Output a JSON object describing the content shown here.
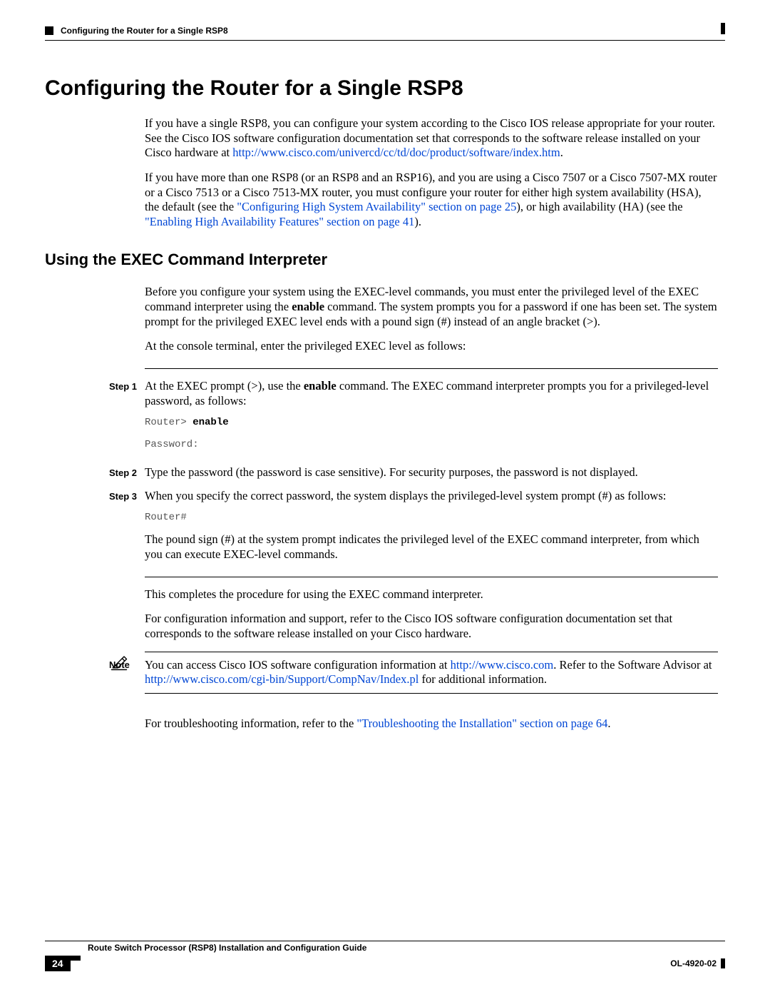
{
  "header": {
    "running_title": "Configuring the Router for a Single RSP8"
  },
  "h1": "Configuring the Router for a Single RSP8",
  "p1a": "If you have a single RSP8, you can configure your system according to the Cisco IOS release appropriate for your router. See the Cisco IOS software configuration documentation set that corresponds to the software release installed on your Cisco hardware at ",
  "p1_link": "http://www.cisco.com/univercd/cc/td/doc/product/software/index.htm",
  "p1b": ".",
  "p2a": "If you have more than one RSP8 (or an RSP8 and an RSP16), and you are using a Cisco 7507 or a Cisco 7507-MX router or a Cisco 7513 or a Cisco 7513-MX router, you must configure your router for either high system availability (HSA), the default (see the ",
  "p2_link1": "\"Configuring High System Availability\" section on page 25",
  "p2b": "), or high availability (HA) (see the ",
  "p2_link2": "\"Enabling High Availability Features\" section on page 41",
  "p2c": ").",
  "h2": "Using the EXEC Command Interpreter",
  "p3a": "Before you configure your system using the EXEC-level commands, you must enter the privileged level of the EXEC command interpreter using the ",
  "p3bold": "enable",
  "p3b": " command. The system prompts you for a password if one has been set. The system prompt for the privileged EXEC level ends with a pound sign (#) instead of an angle bracket (>).",
  "p4": "At the console terminal, enter the privileged EXEC level as follows:",
  "steps": {
    "s1_label": "Step 1",
    "s1a": "At the EXEC prompt (>), use the ",
    "s1bold": "enable",
    "s1b": " command. The EXEC command interpreter prompts you for a privileged-level password, as follows:",
    "s1_code1_a": "Router> ",
    "s1_code1_b": "enable",
    "s1_code2": "Password:",
    "s2_label": "Step 2",
    "s2": "Type the password (the password is case sensitive). For security purposes, the password is not displayed.",
    "s3_label": "Step 3",
    "s3": "When you specify the correct password, the system displays the privileged-level system prompt (#) as follows:",
    "s3_code": "Router#",
    "s3_tail": "The pound sign (#) at the system prompt indicates the privileged level of the EXEC command interpreter, from which you can execute EXEC-level commands."
  },
  "p5": "This completes the procedure for using the EXEC command interpreter.",
  "p6": "For configuration information and support, refer to the Cisco IOS software configuration documentation set that corresponds to the software release installed on your Cisco hardware.",
  "note": {
    "label": "Note",
    "a": "You can access Cisco IOS software configuration information at ",
    "link1": "http://www.cisco.com",
    "b": ". Refer to the Software Advisor at ",
    "link2": "http://www.cisco.com/cgi-bin/Support/CompNav/Index.pl",
    "c": " for additional information."
  },
  "p7a": "For troubleshooting information, refer to the ",
  "p7_link": "\"Troubleshooting the Installation\" section on page 64",
  "p7b": ".",
  "footer": {
    "guide": "Route Switch Processor (RSP8) Installation and Configuration Guide",
    "page": "24",
    "docid": "OL-4920-02"
  }
}
